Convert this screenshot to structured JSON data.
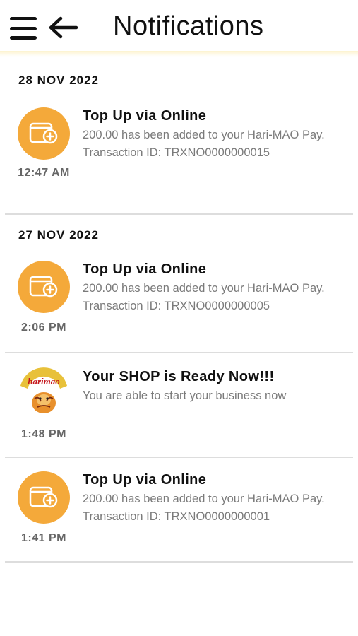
{
  "header": {
    "title": "Notifications",
    "menu_icon": "hamburger-menu-icon",
    "back_icon": "arrow-left-icon"
  },
  "colors": {
    "accent": "#f4a93a",
    "divider": "#dddddd",
    "header_shadow": "#fdf3cf"
  },
  "groups": [
    {
      "date": "28 NOV 2022",
      "items": [
        {
          "icon": "wallet-add-icon",
          "time": "12:47 AM",
          "title": "Top Up via Online",
          "body": "200.00 has been added to your Hari-MAO Pay. Transaction ID: TRXNO0000000015"
        }
      ]
    },
    {
      "date": "27 NOV 2022",
      "items": [
        {
          "icon": "wallet-add-icon",
          "time": "2:06 PM",
          "title": "Top Up via Online",
          "body": "200.00 has been added to your Hari-MAO Pay. Transaction ID: TRXNO0000000005"
        },
        {
          "icon": "harimao-logo",
          "logo_text": "harimao",
          "time": "1:48 PM",
          "title": "Your SHOP is Ready Now!!!",
          "body": "You are able to start your business now"
        },
        {
          "icon": "wallet-add-icon",
          "time": "1:41 PM",
          "title": "Top Up via Online",
          "body": "200.00 has been added to your Hari-MAO Pay. Transaction ID: TRXNO0000000001"
        }
      ]
    }
  ]
}
